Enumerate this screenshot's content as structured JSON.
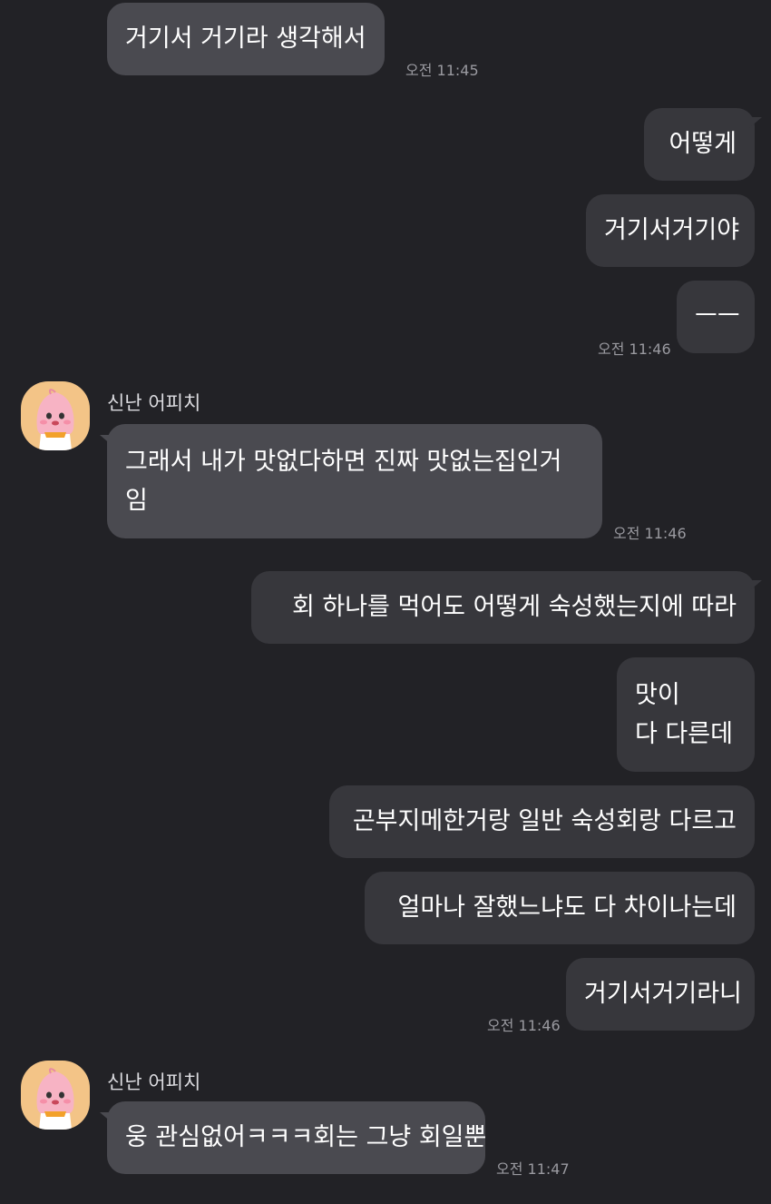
{
  "colors": {
    "background": "#222226",
    "incoming_bubble": "#4a4a50",
    "outgoing_bubble": "#37373c",
    "timestamp": "#9a9aa0"
  },
  "messages": [
    {
      "dir": "in",
      "text": "거기서 거기라 생각해서"
    },
    {
      "dir": "out",
      "text": "어떻게"
    },
    {
      "dir": "out",
      "text": "거기서거기야"
    },
    {
      "dir": "out",
      "text": "ㅡㅡ"
    },
    {
      "dir": "in",
      "text_line1": "그래서 내가 맛없다하면 진짜 맛없는집인거",
      "text_line2": "임"
    },
    {
      "dir": "out",
      "text": "회 하나를 먹어도 어떻게 숙성했는지에 따라"
    },
    {
      "dir": "out",
      "text_line1": "맛이",
      "text_line2": "다 다른데"
    },
    {
      "dir": "out",
      "text": "곤부지메한거랑 일반 숙성회랑 다르고"
    },
    {
      "dir": "out",
      "text": "얼마나 잘했느냐도 다 차이나는데"
    },
    {
      "dir": "out",
      "text": "거기서거기라니"
    },
    {
      "dir": "in",
      "text": "웅 관심없어ㅋㅋㅋ회는 그냥 회일뿐"
    }
  ],
  "timestamps": [
    "오전 11:45",
    "오전 11:46",
    "오전 11:46",
    "오전 11:46",
    "오전 11:47"
  ],
  "senders": [
    {
      "name": "신난 어피치",
      "avatar_icon": "apeach-avatar-icon"
    },
    {
      "name": "신난 어피치",
      "avatar_icon": "apeach-avatar-icon"
    }
  ]
}
